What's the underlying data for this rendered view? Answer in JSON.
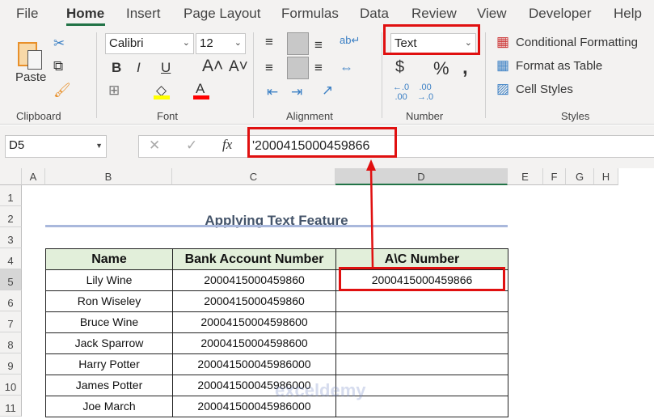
{
  "menu_tabs": [
    "File",
    "Home",
    "Insert",
    "Page Layout",
    "Formulas",
    "Data",
    "Review",
    "View",
    "Developer",
    "Help"
  ],
  "ribbon": {
    "clipboard": {
      "paste_label": "Paste",
      "group_label": "Clipboard"
    },
    "font": {
      "font_name": "Calibri",
      "font_size": "12",
      "group_label": "Font",
      "fill_color": "#ffff00",
      "font_color": "#ff0000"
    },
    "alignment": {
      "group_label": "Alignment"
    },
    "number": {
      "format": "Text",
      "group_label": "Number"
    },
    "styles": {
      "conditional_formatting": "Conditional Formatting",
      "format_as_table": "Format as Table",
      "cell_styles": "Cell Styles",
      "group_label": "Styles"
    }
  },
  "formula_bar": {
    "name_box": "D5",
    "formula": "'2000415000459866"
  },
  "columns": [
    "A",
    "B",
    "C",
    "D",
    "E",
    "F",
    "G",
    "H"
  ],
  "rows": [
    "1",
    "2",
    "3",
    "4",
    "5",
    "6",
    "7",
    "8",
    "9",
    "10",
    "11"
  ],
  "sheet": {
    "title": "Applying Text Feature",
    "headers": [
      "Name",
      "Bank Account Number",
      "A\\C Number"
    ],
    "data": [
      [
        "Lily Wine",
        "2000415000459860",
        "2000415000459866"
      ],
      [
        "Ron Wiseley",
        "2000415000459860",
        ""
      ],
      [
        "Bruce Wine",
        "20004150004598600",
        ""
      ],
      [
        "Jack Sparrow",
        "20004150004598600",
        ""
      ],
      [
        "Harry Potter",
        "200041500045986000",
        ""
      ],
      [
        "James Potter",
        "200041500045986000",
        ""
      ],
      [
        "Joe March",
        "200041500045986000",
        ""
      ]
    ]
  },
  "watermark": "exceldemy EXCEL · DATA · BI",
  "highlight_color": "#e01010"
}
